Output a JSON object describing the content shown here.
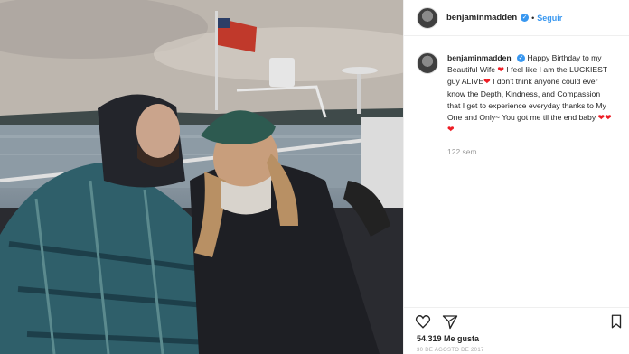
{
  "post": {
    "username": "benjaminmadden",
    "follow_label": "Seguir",
    "separator": "•",
    "caption_parts": [
      "Happy Birthday to my Beautiful Wife ",
      " I feel like I am the LUCKIEST guy ALIVE",
      " I don't think anyone could ever know the Depth, Kindness, and Compassion that I get to experience everyday thanks to My One and Only~ You got me til the end baby"
    ],
    "heart": "❤",
    "time_ago": "122 sem",
    "likes": "54.319 Me gusta",
    "date": "30 DE AGOSTO DE 2017"
  },
  "icons": {
    "like": "heart-outline-icon",
    "share": "paper-plane-icon",
    "save": "bookmark-icon",
    "verified": "verified-badge-icon"
  },
  "colors": {
    "link_blue": "#3897f0",
    "heart_red": "#ed1c24",
    "text": "#262626",
    "muted": "#999999"
  }
}
